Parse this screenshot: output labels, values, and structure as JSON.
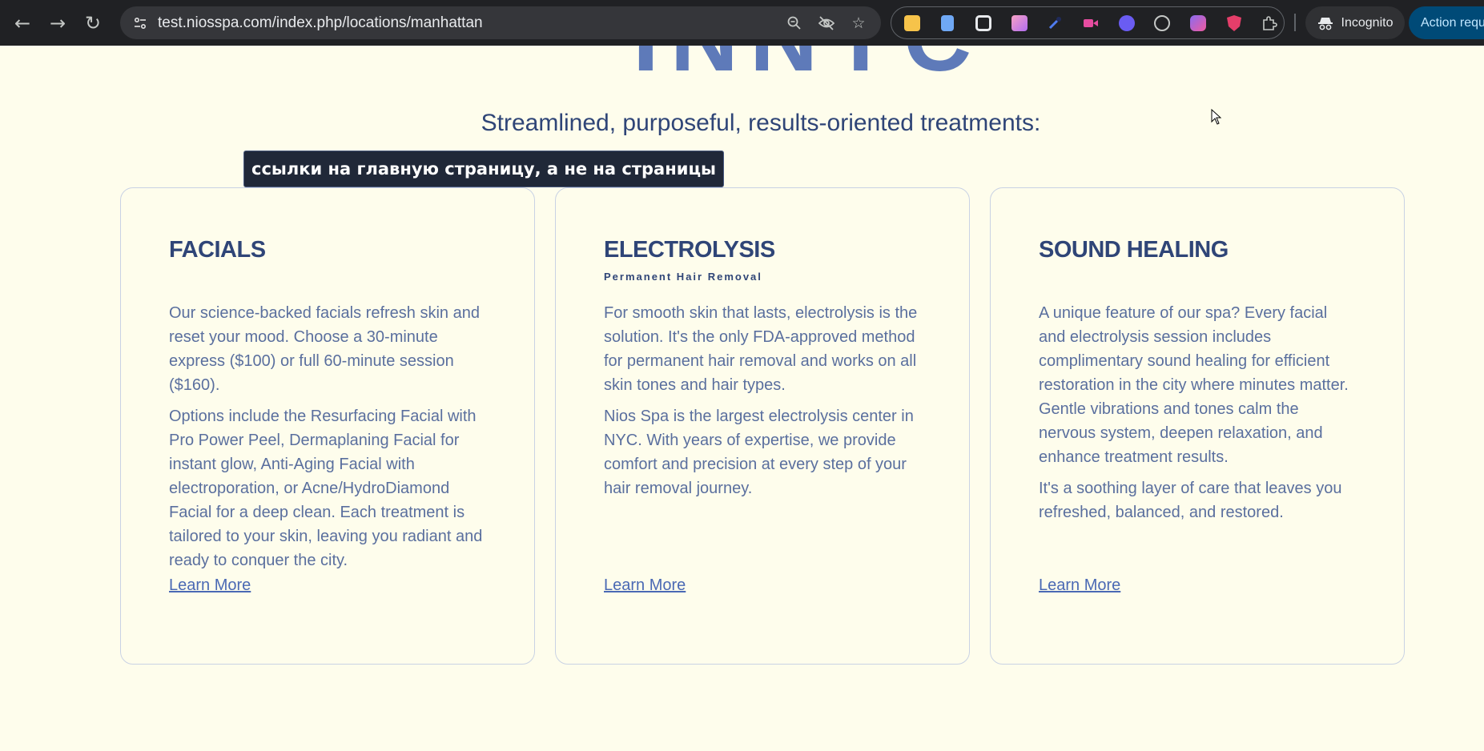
{
  "browser": {
    "url": "test.niosspa.com/index.php/locations/manhattan",
    "incognito_label": "Incognito",
    "action_label": "Action required",
    "extensions": [
      {
        "icon": "notes-extension-icon",
        "color": "#f6c34a"
      },
      {
        "icon": "docs-extension-icon",
        "color": "#6fa8f5"
      },
      {
        "icon": "camera-extension-icon",
        "color": "#e8eaed"
      },
      {
        "icon": "gradient-extension-icon",
        "color": "#f08fb4"
      },
      {
        "icon": "eyedropper-extension-icon",
        "color": "#4f7cf0"
      },
      {
        "icon": "video-extension-icon",
        "color": "#e64ca0"
      },
      {
        "icon": "stack-extension-icon",
        "color": "#6a5cf2"
      },
      {
        "icon": "compass-extension-icon",
        "color": "#c4c7c5"
      },
      {
        "icon": "lens-extension-icon",
        "color": "#8a6cf0"
      },
      {
        "icon": "ublock-extension-icon",
        "color": "#e53e6a"
      },
      {
        "icon": "puzzle-extensions-icon",
        "color": "#c4c7c5"
      }
    ]
  },
  "page": {
    "hero_fragment": "INNYC",
    "section_heading": "Streamlined, purposeful, results-oriented treatments:",
    "tooltip": "ссылки на главную страницу, а не на страницы",
    "cards": [
      {
        "title": "FACIALS",
        "subtitle": "",
        "paragraphs": [
          "Our science-backed facials refresh skin and reset your mood. Choose a 30-minute express ($100) or full 60-minute session ($160).",
          "Options include the Resurfacing Facial with Pro Power Peel, Dermaplaning Facial for instant glow, Anti-Aging Facial with electroporation, or Acne/HydroDiamond Facial for a deep clean. Each treatment is tailored to your skin, leaving you radiant and ready to conquer the city."
        ],
        "link": "Learn More"
      },
      {
        "title": "ELECTROLYSIS",
        "subtitle": "Permanent Hair Removal",
        "paragraphs": [
          "For smooth skin that lasts, electrolysis is the solution. It's the only FDA-approved method for permanent hair removal and works on all skin tones and hair types.",
          "Nios Spa is the largest electrolysis center in NYC. With years of expertise, we provide comfort and precision at every step of your hair removal journey."
        ],
        "link": "Learn More"
      },
      {
        "title": "SOUND HEALING",
        "subtitle": "",
        "paragraphs": [
          "A unique feature of our spa? Every facial and electrolysis session includes complimentary sound healing for efficient restoration in the city where minutes matter. Gentle vibrations and tones calm the nervous system, deepen relaxation, and enhance treatment results.",
          "It's a soothing layer of care that leaves you refreshed, balanced, and restored."
        ],
        "link": "Learn More"
      }
    ]
  }
}
